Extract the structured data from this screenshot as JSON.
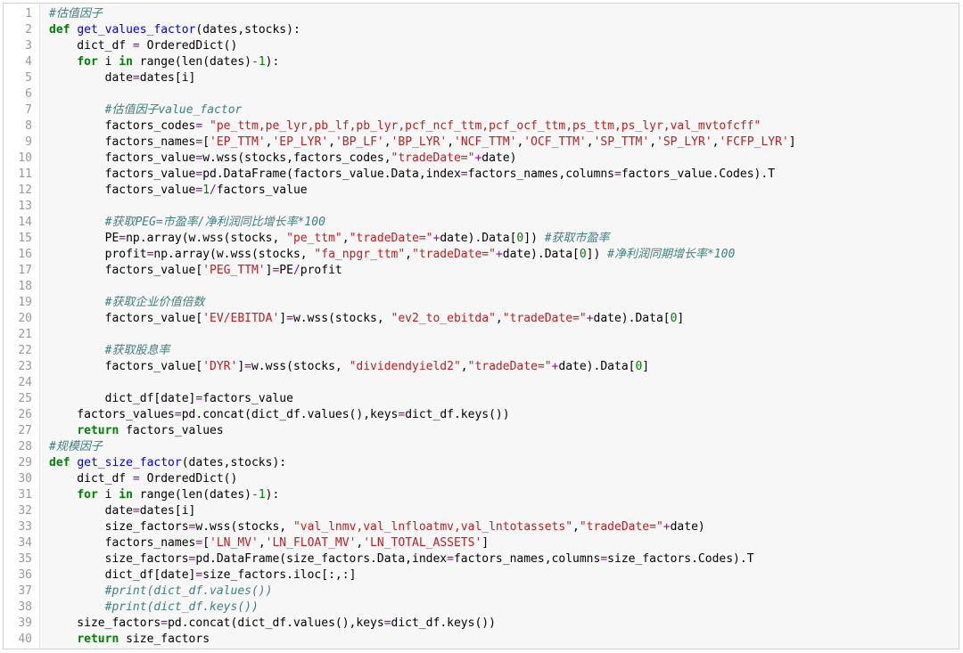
{
  "line_numbers": [
    "1",
    "2",
    "3",
    "4",
    "5",
    "6",
    "7",
    "8",
    "9",
    "10",
    "11",
    "12",
    "13",
    "14",
    "15",
    "16",
    "17",
    "18",
    "19",
    "20",
    "21",
    "22",
    "23",
    "24",
    "25",
    "26",
    "27",
    "28",
    "29",
    "30",
    "31",
    "32",
    "33",
    "34",
    "35",
    "36",
    "37",
    "38",
    "39",
    "40"
  ],
  "code": {
    "lines": [
      [
        {
          "t": "#估值因子",
          "c": "c-comment"
        }
      ],
      [
        {
          "t": "def ",
          "c": "c-kw"
        },
        {
          "t": "get_values_factor",
          "c": "c-def"
        },
        {
          "t": "(dates,stocks):"
        }
      ],
      [
        {
          "t": "    dict_df "
        },
        {
          "t": "=",
          "c": "c-op"
        },
        {
          "t": " OrderedDict()"
        }
      ],
      [
        {
          "t": "    "
        },
        {
          "t": "for",
          "c": "c-kw"
        },
        {
          "t": " i "
        },
        {
          "t": "in",
          "c": "c-kw"
        },
        {
          "t": " range(len(dates)"
        },
        {
          "t": "-",
          "c": "c-op"
        },
        {
          "t": "1",
          "c": "c-num"
        },
        {
          "t": "):"
        }
      ],
      [
        {
          "t": "        date"
        },
        {
          "t": "=",
          "c": "c-op"
        },
        {
          "t": "dates[i]"
        }
      ],
      [],
      [
        {
          "t": "        "
        },
        {
          "t": "#估值因子value_factor",
          "c": "c-comment"
        }
      ],
      [
        {
          "t": "        factors_codes"
        },
        {
          "t": "=",
          "c": "c-op"
        },
        {
          "t": " "
        },
        {
          "t": "\"pe_ttm,pe_lyr,pb_lf,pb_lyr,pcf_ncf_ttm,pcf_ocf_ttm,ps_ttm,ps_lyr,val_mvtofcff\"",
          "c": "c-str"
        }
      ],
      [
        {
          "t": "        factors_names"
        },
        {
          "t": "=",
          "c": "c-op"
        },
        {
          "t": "["
        },
        {
          "t": "'EP_TTM'",
          "c": "c-str"
        },
        {
          "t": ","
        },
        {
          "t": "'EP_LYR'",
          "c": "c-str"
        },
        {
          "t": ","
        },
        {
          "t": "'BP_LF'",
          "c": "c-str"
        },
        {
          "t": ","
        },
        {
          "t": "'BP_LYR'",
          "c": "c-str"
        },
        {
          "t": ","
        },
        {
          "t": "'NCF_TTM'",
          "c": "c-str"
        },
        {
          "t": ","
        },
        {
          "t": "'OCF_TTM'",
          "c": "c-str"
        },
        {
          "t": ","
        },
        {
          "t": "'SP_TTM'",
          "c": "c-str"
        },
        {
          "t": ","
        },
        {
          "t": "'SP_LYR'",
          "c": "c-str"
        },
        {
          "t": ","
        },
        {
          "t": "'FCFP_LYR'",
          "c": "c-str"
        },
        {
          "t": "]"
        }
      ],
      [
        {
          "t": "        factors_value"
        },
        {
          "t": "=",
          "c": "c-op"
        },
        {
          "t": "w.wss(stocks,factors_codes,"
        },
        {
          "t": "\"tradeDate=\"",
          "c": "c-str"
        },
        {
          "t": "+",
          "c": "c-op"
        },
        {
          "t": "date)"
        }
      ],
      [
        {
          "t": "        factors_value"
        },
        {
          "t": "=",
          "c": "c-op"
        },
        {
          "t": "pd.DataFrame(factors_value.Data,index"
        },
        {
          "t": "=",
          "c": "c-op"
        },
        {
          "t": "factors_names,columns"
        },
        {
          "t": "=",
          "c": "c-op"
        },
        {
          "t": "factors_value.Codes).T"
        }
      ],
      [
        {
          "t": "        factors_value"
        },
        {
          "t": "=",
          "c": "c-op"
        },
        {
          "t": "1",
          "c": "c-num"
        },
        {
          "t": "/",
          "c": "c-op"
        },
        {
          "t": "factors_value"
        }
      ],
      [],
      [
        {
          "t": "        "
        },
        {
          "t": "#获取PEG=市盈率/净利润同比增长率*100",
          "c": "c-comment"
        }
      ],
      [
        {
          "t": "        PE"
        },
        {
          "t": "=",
          "c": "c-op"
        },
        {
          "t": "np.array(w.wss(stocks, "
        },
        {
          "t": "\"pe_ttm\"",
          "c": "c-str"
        },
        {
          "t": ","
        },
        {
          "t": "\"tradeDate=\"",
          "c": "c-str"
        },
        {
          "t": "+",
          "c": "c-op"
        },
        {
          "t": "date).Data["
        },
        {
          "t": "0",
          "c": "c-num"
        },
        {
          "t": "]) "
        },
        {
          "t": "#获取市盈率",
          "c": "c-comment"
        }
      ],
      [
        {
          "t": "        profit"
        },
        {
          "t": "=",
          "c": "c-op"
        },
        {
          "t": "np.array(w.wss(stocks, "
        },
        {
          "t": "\"fa_npgr_ttm\"",
          "c": "c-str"
        },
        {
          "t": ","
        },
        {
          "t": "\"tradeDate=\"",
          "c": "c-str"
        },
        {
          "t": "+",
          "c": "c-op"
        },
        {
          "t": "date).Data["
        },
        {
          "t": "0",
          "c": "c-num"
        },
        {
          "t": "]) "
        },
        {
          "t": "#净利润同期增长率*100",
          "c": "c-comment"
        }
      ],
      [
        {
          "t": "        factors_value["
        },
        {
          "t": "'PEG_TTM'",
          "c": "c-str"
        },
        {
          "t": "]"
        },
        {
          "t": "=",
          "c": "c-op"
        },
        {
          "t": "PE"
        },
        {
          "t": "/",
          "c": "c-op"
        },
        {
          "t": "profit"
        }
      ],
      [],
      [
        {
          "t": "        "
        },
        {
          "t": "#获取企业价值倍数",
          "c": "c-comment"
        }
      ],
      [
        {
          "t": "        factors_value["
        },
        {
          "t": "'EV/EBITDA'",
          "c": "c-str"
        },
        {
          "t": "]"
        },
        {
          "t": "=",
          "c": "c-op"
        },
        {
          "t": "w.wss(stocks, "
        },
        {
          "t": "\"ev2_to_ebitda\"",
          "c": "c-str"
        },
        {
          "t": ","
        },
        {
          "t": "\"tradeDate=\"",
          "c": "c-str"
        },
        {
          "t": "+",
          "c": "c-op"
        },
        {
          "t": "date).Data["
        },
        {
          "t": "0",
          "c": "c-num"
        },
        {
          "t": "]"
        }
      ],
      [],
      [
        {
          "t": "        "
        },
        {
          "t": "#获取股息率",
          "c": "c-comment"
        }
      ],
      [
        {
          "t": "        factors_value["
        },
        {
          "t": "'DYR'",
          "c": "c-str"
        },
        {
          "t": "]"
        },
        {
          "t": "=",
          "c": "c-op"
        },
        {
          "t": "w.wss(stocks, "
        },
        {
          "t": "\"dividendyield2\"",
          "c": "c-str"
        },
        {
          "t": ","
        },
        {
          "t": "\"tradeDate=\"",
          "c": "c-str"
        },
        {
          "t": "+",
          "c": "c-op"
        },
        {
          "t": "date).Data["
        },
        {
          "t": "0",
          "c": "c-num"
        },
        {
          "t": "]"
        }
      ],
      [],
      [
        {
          "t": "        dict_df[date]"
        },
        {
          "t": "=",
          "c": "c-op"
        },
        {
          "t": "factors_value"
        }
      ],
      [
        {
          "t": "    factors_values"
        },
        {
          "t": "=",
          "c": "c-op"
        },
        {
          "t": "pd.concat(dict_df.values(),keys"
        },
        {
          "t": "=",
          "c": "c-op"
        },
        {
          "t": "dict_df.keys())"
        }
      ],
      [
        {
          "t": "    "
        },
        {
          "t": "return",
          "c": "c-kw"
        },
        {
          "t": " factors_values"
        }
      ],
      [
        {
          "t": "#规模因子",
          "c": "c-comment"
        }
      ],
      [
        {
          "t": "def ",
          "c": "c-kw"
        },
        {
          "t": "get_size_factor",
          "c": "c-def"
        },
        {
          "t": "(dates,stocks):"
        }
      ],
      [
        {
          "t": "    dict_df "
        },
        {
          "t": "=",
          "c": "c-op"
        },
        {
          "t": " OrderedDict()"
        }
      ],
      [
        {
          "t": "    "
        },
        {
          "t": "for",
          "c": "c-kw"
        },
        {
          "t": " i "
        },
        {
          "t": "in",
          "c": "c-kw"
        },
        {
          "t": " range(len(dates)"
        },
        {
          "t": "-",
          "c": "c-op"
        },
        {
          "t": "1",
          "c": "c-num"
        },
        {
          "t": "):"
        }
      ],
      [
        {
          "t": "        date"
        },
        {
          "t": "=",
          "c": "c-op"
        },
        {
          "t": "dates[i]"
        }
      ],
      [
        {
          "t": "        size_factors"
        },
        {
          "t": "=",
          "c": "c-op"
        },
        {
          "t": "w.wss(stocks, "
        },
        {
          "t": "\"val_lnmv,val_lnfloatmv,val_lntotassets\"",
          "c": "c-str"
        },
        {
          "t": ","
        },
        {
          "t": "\"tradeDate=\"",
          "c": "c-str"
        },
        {
          "t": "+",
          "c": "c-op"
        },
        {
          "t": "date)"
        }
      ],
      [
        {
          "t": "        factors_names"
        },
        {
          "t": "=",
          "c": "c-op"
        },
        {
          "t": "["
        },
        {
          "t": "'LN_MV'",
          "c": "c-str"
        },
        {
          "t": ","
        },
        {
          "t": "'LN_FLOAT_MV'",
          "c": "c-str"
        },
        {
          "t": ","
        },
        {
          "t": "'LN_TOTAL_ASSETS'",
          "c": "c-str"
        },
        {
          "t": "]"
        }
      ],
      [
        {
          "t": "        size_factors"
        },
        {
          "t": "=",
          "c": "c-op"
        },
        {
          "t": "pd.DataFrame(size_factors.Data,index"
        },
        {
          "t": "=",
          "c": "c-op"
        },
        {
          "t": "factors_names,columns"
        },
        {
          "t": "=",
          "c": "c-op"
        },
        {
          "t": "size_factors.Codes).T"
        }
      ],
      [
        {
          "t": "        dict_df[date]"
        },
        {
          "t": "=",
          "c": "c-op"
        },
        {
          "t": "size_factors.iloc[:,:]"
        }
      ],
      [
        {
          "t": "        "
        },
        {
          "t": "#print(dict_df.values())",
          "c": "c-comment"
        }
      ],
      [
        {
          "t": "        "
        },
        {
          "t": "#print(dict_df.keys())",
          "c": "c-comment"
        }
      ],
      [
        {
          "t": "    size_factors"
        },
        {
          "t": "=",
          "c": "c-op"
        },
        {
          "t": "pd.concat(dict_df.values(),keys"
        },
        {
          "t": "=",
          "c": "c-op"
        },
        {
          "t": "dict_df.keys())"
        }
      ],
      [
        {
          "t": "    "
        },
        {
          "t": "return",
          "c": "c-kw"
        },
        {
          "t": " size_factors"
        }
      ]
    ]
  }
}
